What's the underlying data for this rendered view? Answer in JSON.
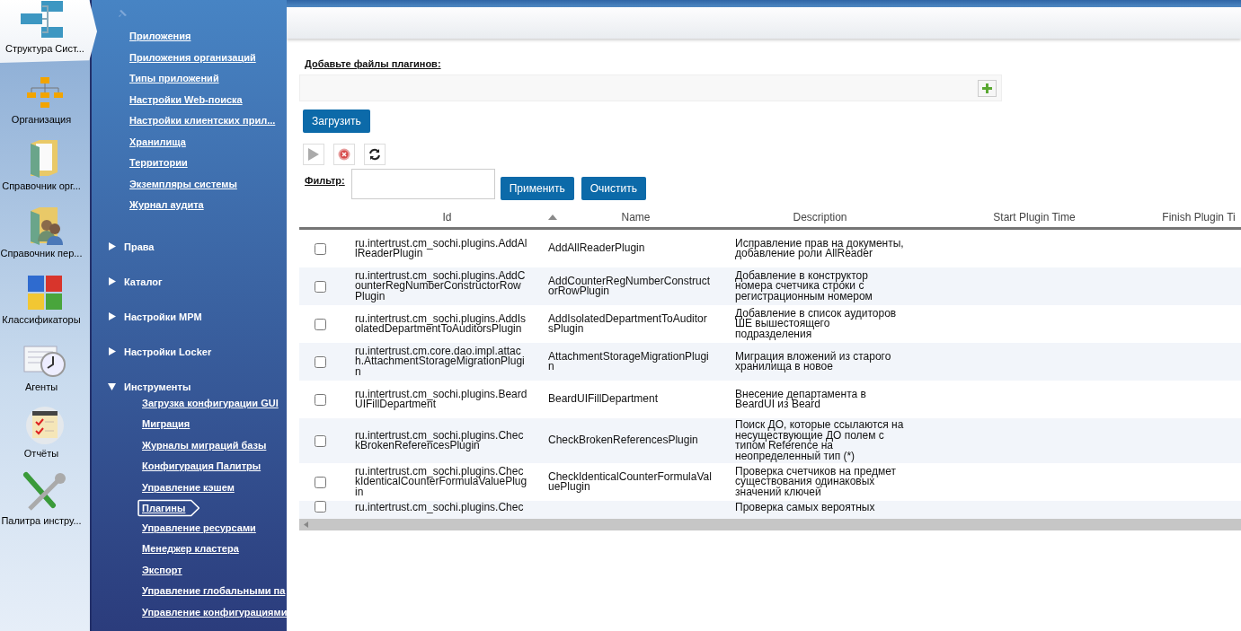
{
  "rail": [
    {
      "label": "Структура Сист...",
      "selected": true
    },
    {
      "label": "Организация",
      "selected": false
    },
    {
      "label": "Справочник орг...",
      "selected": false
    },
    {
      "label": "Справочник пер...",
      "selected": false
    },
    {
      "label": "Классификаторы",
      "selected": false
    },
    {
      "label": "Агенты",
      "selected": false
    },
    {
      "label": "Отчёты",
      "selected": false
    },
    {
      "label": "Палитра инстру...",
      "selected": false
    }
  ],
  "nav": {
    "links": [
      "Приложения",
      "Приложения организаций",
      "Типы приложений",
      "Настройки Web-поиска",
      "Настройки клиентских прил...",
      "Хранилища",
      "Территории",
      "Экземпляры системы",
      "Журнал аудита"
    ],
    "groups": [
      {
        "label": "Права",
        "expanded": false
      },
      {
        "label": "Каталог",
        "expanded": false
      },
      {
        "label": "Настройки MPM",
        "expanded": false
      },
      {
        "label": "Настройки Locker",
        "expanded": false
      },
      {
        "label": "Инструменты",
        "expanded": true,
        "children": [
          {
            "label": "Загрузка конфигурации GUI",
            "selected": false
          },
          {
            "label": "Миграция",
            "selected": false
          },
          {
            "label": "Журналы миграций базы",
            "selected": false
          },
          {
            "label": "Конфигурация Палитры",
            "selected": false
          },
          {
            "label": "Управление кэшем",
            "selected": false
          },
          {
            "label": "Плагины",
            "selected": true
          },
          {
            "label": "Управление ресурсами",
            "selected": false
          },
          {
            "label": "Менеджер кластера",
            "selected": false
          },
          {
            "label": "Экспорт",
            "selected": false
          },
          {
            "label": "Управление глобальными па",
            "selected": false
          },
          {
            "label": "Управление конфигурациями",
            "selected": false
          }
        ]
      }
    ]
  },
  "upload": {
    "label": "Добавьте файлы плагинов:",
    "button": "Загрузить"
  },
  "filter": {
    "label": "Фильтр:",
    "apply": "Применить",
    "clear": "Очистить"
  },
  "table": {
    "columns": [
      {
        "label": "Id",
        "sorted": false
      },
      {
        "label": "Name",
        "sorted": true
      },
      {
        "label": "Description",
        "sorted": false
      },
      {
        "label": "Start Plugin Time",
        "sorted": false
      },
      {
        "label": "Finish Plugin Ti",
        "sorted": false
      }
    ],
    "rows": [
      {
        "checked": false,
        "id": "ru.intertrust.cm_sochi.plugins.AddAllReaderPlugin",
        "name": "AddAllReaderPlugin",
        "description": "Исправление прав на документы, добавление роли AllReader"
      },
      {
        "checked": false,
        "id": "ru.intertrust.cm_sochi.plugins.AddCounterRegNumberConstructorRowPlugin",
        "name": "AddCounterRegNumberConstructorRowPlugin",
        "description": "Добавление в конструктор номера счетчика строки с регистрационным номером"
      },
      {
        "checked": false,
        "id": "ru.intertrust.cm_sochi.plugins.AddIsolatedDepartmentToAuditorsPlugin",
        "name": "AddIsolatedDepartmentToAuditorsPlugin",
        "description": "Добавление в список аудиторов ШЕ вышестоящего подразделения"
      },
      {
        "checked": false,
        "id": "ru.intertrust.cm.core.dao.impl.attach.AttachmentStorageMigrationPlugin",
        "name": "AttachmentStorageMigrationPlugin",
        "description": "Миграция вложений из старого хранилища в новое"
      },
      {
        "checked": false,
        "id": "ru.intertrust.cm_sochi.plugins.BeardUIFillDepartment",
        "name": "BeardUIFillDepartment",
        "description": "Внесение департамента в BeardUI из Beard"
      },
      {
        "checked": false,
        "id": "ru.intertrust.cm_sochi.plugins.CheckBrokenReferencesPlugin",
        "name": "CheckBrokenReferencesPlugin",
        "description": "Поиск ДО, которые ссылаются на несуществующие ДО полем с типом Reference на неопределенный тип (*)"
      },
      {
        "checked": false,
        "id": "ru.intertrust.cm_sochi.plugins.CheckIdenticalCounterFormulaValuePlugin",
        "name": "CheckIdenticalCounterFormulaValuePlugin",
        "description": "Проверка счетчиков на предмет существования одинаковых значений ключей"
      },
      {
        "checked": false,
        "id": "ru.intertrust.cm_sochi.plugins.Chec",
        "description": "Проверка самых вероятных"
      }
    ]
  }
}
